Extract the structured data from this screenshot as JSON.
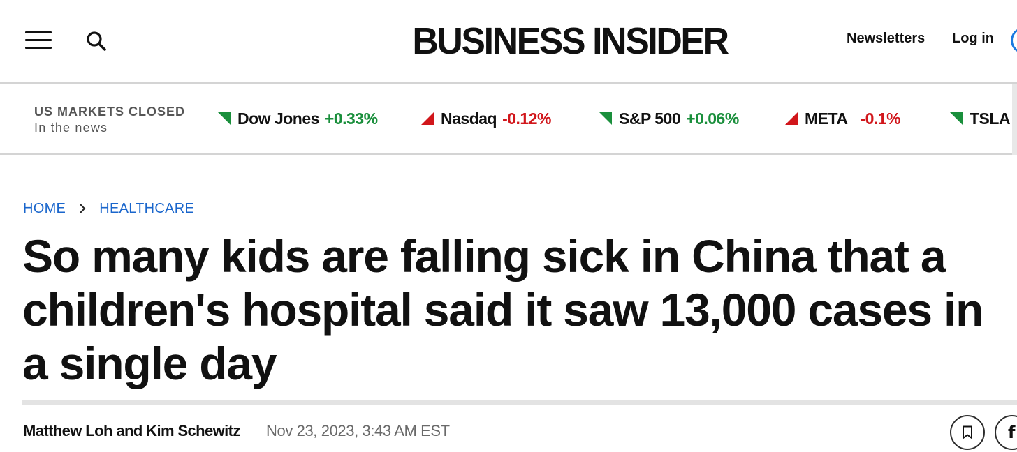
{
  "header": {
    "logo": "BUSINESS INSIDER",
    "nav": {
      "newsletters": "Newsletters",
      "login": "Log in"
    },
    "icons": {
      "menu": "hamburger-menu-icon",
      "search": "search-icon",
      "avatar": "user-avatar-icon"
    }
  },
  "markets": {
    "status": "US MARKETS CLOSED",
    "subtitle": "In the news",
    "tickers": [
      {
        "name": "Dow Jones",
        "change": "+0.33%",
        "direction": "up"
      },
      {
        "name": "Nasdaq",
        "change": "-0.12%",
        "direction": "down"
      },
      {
        "name": "S&P 500",
        "change": "+0.06%",
        "direction": "up"
      },
      {
        "name": "META",
        "change": "-0.1%",
        "direction": "down"
      },
      {
        "name": "TSLA",
        "change": "",
        "direction": "up"
      }
    ],
    "colors": {
      "up": "#1a8f3c",
      "down": "#d1161b"
    }
  },
  "breadcrumb": {
    "items": [
      "HOME",
      "HEALTHCARE"
    ],
    "separator_icon": "chevron-right-icon"
  },
  "article": {
    "headline": "So many kids are falling sick in China that a children's hospital said it saw 13,000 cases in a single day",
    "authors": "Matthew Loh and Kim Schewitz",
    "date": "Nov 23, 2023, 3:43 AM EST",
    "actions": {
      "bookmark_icon": "bookmark-icon",
      "share_icon": "facebook-icon"
    }
  },
  "colors": {
    "link": "#1a66cc",
    "text": "#111111",
    "muted": "#6a6a6a",
    "divider": "#d4d4d4"
  }
}
